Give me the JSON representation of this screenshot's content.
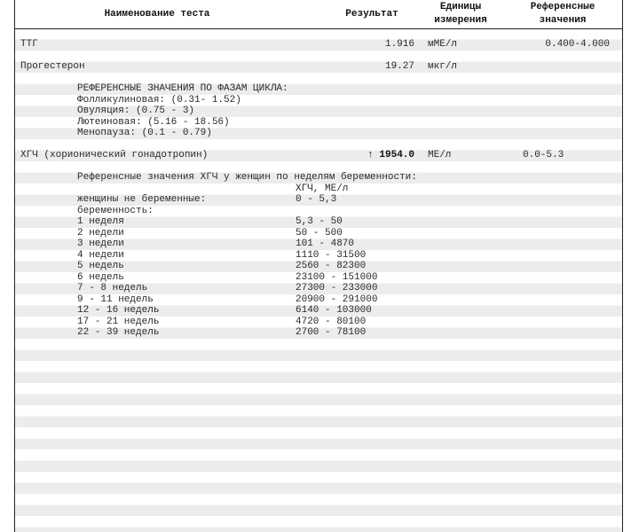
{
  "header": {
    "name": "Наименование теста",
    "result": "Результат",
    "units_line1": "Единицы",
    "units_line2": "измерения",
    "ref_line1": "Референсные",
    "ref_line2": "значения"
  },
  "tests": {
    "ttg": {
      "name": "ТТГ",
      "result": "1.916",
      "units": "мМЕ/л",
      "ref": "0.400-4.000"
    },
    "progesterone": {
      "name": "Прогестерон",
      "result": "19.27",
      "units": "мкг/л",
      "ref": "",
      "notes": [
        "РЕФЕРЕНСНЫЕ ЗНАЧЕНИЯ ПО ФАЗАМ ЦИКЛА:",
        "Фолликулиновая: (0.31- 1.52)",
        "Овуляция: (0.75 - 3)",
        "Лютеиновая: (5.16 - 18.56)",
        "Менопауза: (0.1 - 0.79)"
      ]
    },
    "hcg": {
      "name": "ХГЧ (хорионический гонадотропин)",
      "flag": "↑",
      "result": "1954.0",
      "units": "МЕ/л",
      "ref": "0.0-5.3",
      "notes_title": "Референсные значения ХГЧ у женщин по неделям беременности:",
      "notes_subheader": "ХГЧ, МЕ/л",
      "rows": [
        {
          "label": "женщины не беременные:",
          "value": "0 - 5,3"
        },
        {
          "label": "беременность:",
          "value": ""
        },
        {
          "label": "1 неделя",
          "value": "5,3 - 50"
        },
        {
          "label": "2 недели",
          "value": "50 - 500"
        },
        {
          "label": "3 недели",
          "value": "101 - 4870"
        },
        {
          "label": "4 недели",
          "value": "1110 - 31500"
        },
        {
          "label": "5 недель",
          "value": "2560 - 82300"
        },
        {
          "label": "6 недель",
          "value": "23100 - 151000"
        },
        {
          "label": "7 - 8 недель",
          "value": "27300 - 233000"
        },
        {
          "label": "9 - 11 недель",
          "value": "20900 - 291000"
        },
        {
          "label": "12 - 16 недель",
          "value": "6140 - 103000"
        },
        {
          "label": "17 - 21 недель",
          "value": "4720 - 80100"
        },
        {
          "label": "22 - 39 недель",
          "value": "2700 - 78100"
        }
      ]
    }
  }
}
